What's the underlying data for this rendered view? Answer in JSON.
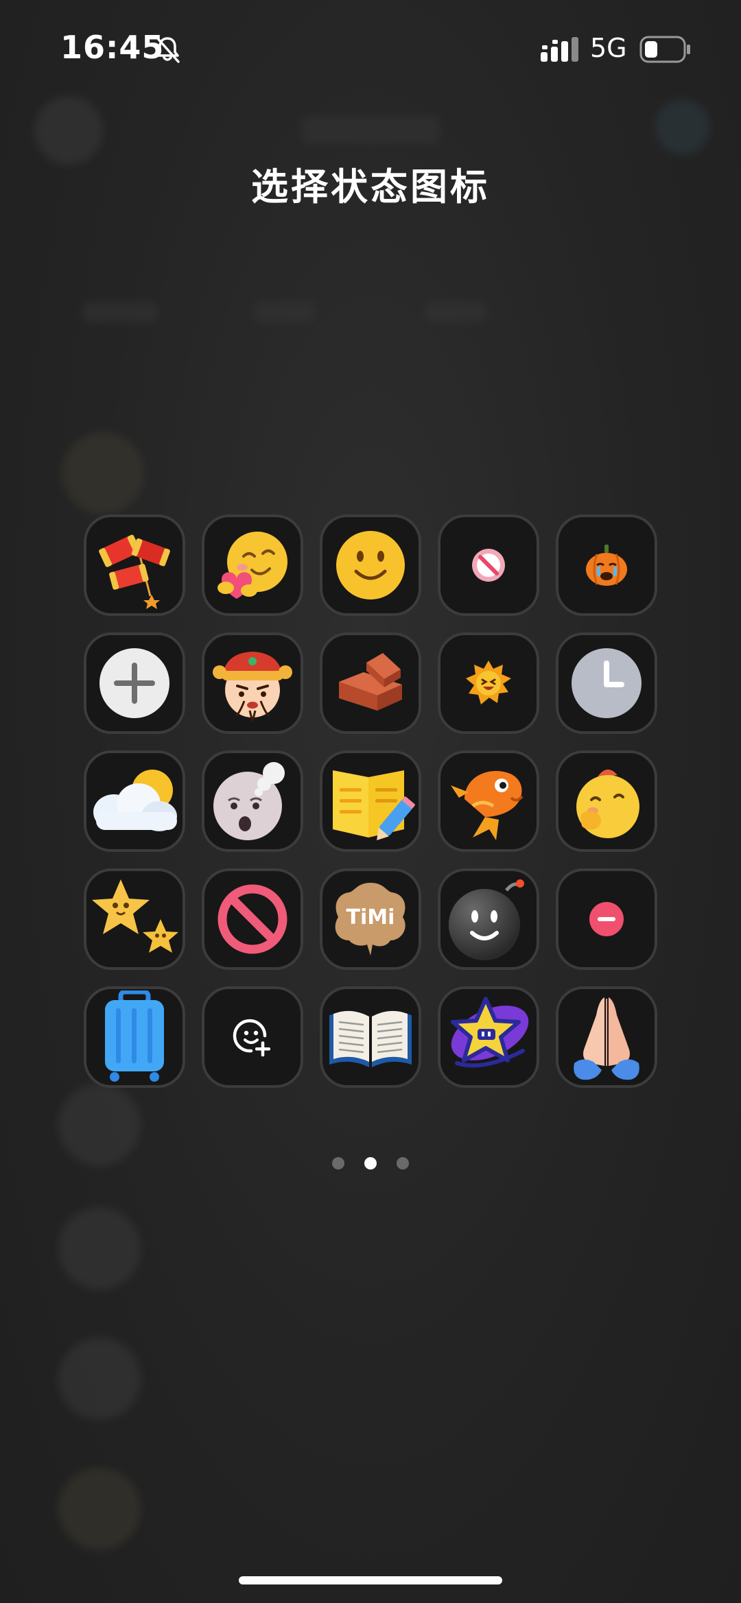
{
  "status_bar": {
    "time": "16:45",
    "network": "5G",
    "icons": [
      "bell-slash-icon",
      "signal-icon",
      "battery-icon"
    ],
    "battery_level": 0.3
  },
  "title": "选择状态图标",
  "icons": [
    [
      "firecracker-icon",
      "hugging-face-icon",
      "smiley-face-icon",
      "no-entry-small-icon",
      "pumpkin-crying-icon"
    ],
    [
      "add-circle-icon",
      "god-of-wealth-icon",
      "brick-icon",
      "grinning-sun-icon",
      "clock-icon"
    ],
    [
      "cloud-sun-icon",
      "sleepy-face-icon",
      "notebook-pencil-icon",
      "koi-fish-icon",
      "yawning-chick-icon"
    ],
    [
      "stars-icon",
      "prohibited-icon",
      "timi-badge-icon",
      "bomb-icon",
      "minus-circle-icon"
    ],
    [
      "suitcase-icon",
      "add-emoji-icon",
      "open-book-icon",
      "star-badge-icon",
      "folded-hands-icon"
    ]
  ],
  "badges": {
    "timi_label": "TiMi"
  },
  "pager": {
    "count": 3,
    "active_index": 1
  },
  "colors": {
    "tile_border": "#3c3c3c",
    "tile_bg": "#171717",
    "text": "#ffffff"
  }
}
